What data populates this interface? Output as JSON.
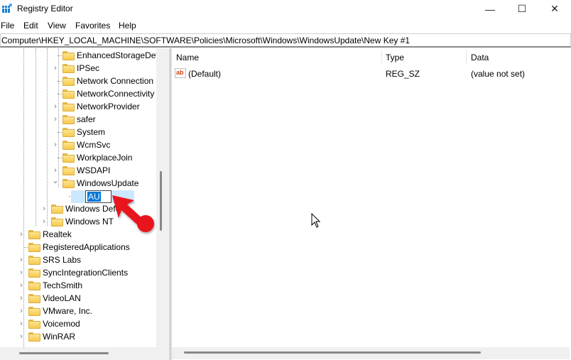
{
  "window": {
    "title": "Registry Editor",
    "controls": {
      "minimize": "—",
      "maximize": "☐",
      "close": "✕"
    }
  },
  "menu": [
    "File",
    "Edit",
    "View",
    "Favorites",
    "Help"
  ],
  "address": "Computer\\HKEY_LOCAL_MACHINE\\SOFTWARE\\Policies\\Microsoft\\Windows\\WindowsUpdate\\New Key #1",
  "tree": {
    "items": [
      {
        "label": "EnhancedStorageDev",
        "expander": "none"
      },
      {
        "label": "IPSec",
        "expander": "collapsed"
      },
      {
        "label": "Network Connection",
        "expander": "none"
      },
      {
        "label": "NetworkConnectivity",
        "expander": "none"
      },
      {
        "label": "NetworkProvider",
        "expander": "collapsed"
      },
      {
        "label": "safer",
        "expander": "collapsed"
      },
      {
        "label": "System",
        "expander": "none"
      },
      {
        "label": "WcmSvc",
        "expander": "collapsed"
      },
      {
        "label": "WorkplaceJoin",
        "expander": "none"
      },
      {
        "label": "WSDAPI",
        "expander": "collapsed"
      },
      {
        "label": "WindowsUpdate",
        "expander": "expanded"
      },
      {
        "label": "AU",
        "expander": "none",
        "editing": true
      },
      {
        "label": "Windows Defe",
        "expander": "collapsed"
      },
      {
        "label": "Windows NT",
        "expander": "collapsed"
      },
      {
        "label": "Realtek",
        "expander": "collapsed"
      },
      {
        "label": "RegisteredApplications",
        "expander": "none"
      },
      {
        "label": "SRS Labs",
        "expander": "collapsed"
      },
      {
        "label": "SyncIntegrationClients",
        "expander": "collapsed"
      },
      {
        "label": "TechSmith",
        "expander": "collapsed"
      },
      {
        "label": "VideoLAN",
        "expander": "collapsed"
      },
      {
        "label": "VMware, Inc.",
        "expander": "collapsed"
      },
      {
        "label": "Voicemod",
        "expander": "collapsed"
      },
      {
        "label": "WinRAR",
        "expander": "collapsed"
      }
    ]
  },
  "list": {
    "columns": [
      "Name",
      "Type",
      "Data"
    ],
    "rows": [
      {
        "icon": "ab",
        "name": "(Default)",
        "type": "REG_SZ",
        "data": "(value not set)"
      }
    ]
  },
  "colors": {
    "selection": "#cce8ff",
    "edit_highlight": "#0078d7",
    "annotation_arrow": "#e8141c"
  }
}
